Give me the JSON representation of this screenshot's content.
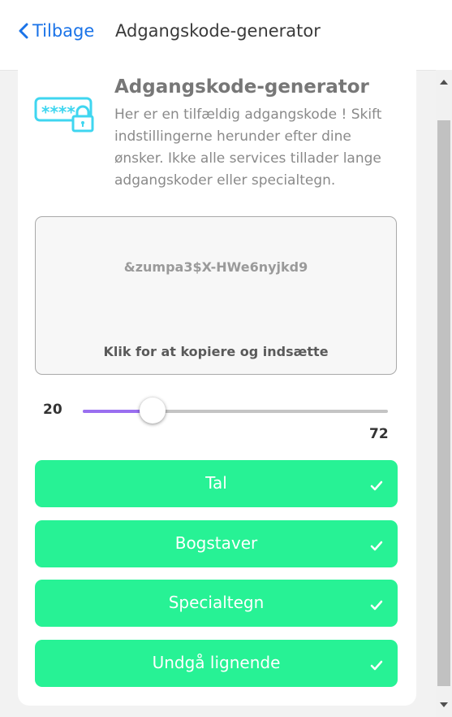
{
  "header": {
    "back_label": "Tilbage",
    "title": "Adgangskode-generator"
  },
  "info": {
    "title": "Adgangskode-generator",
    "description": "Her er en tilfældig adgangskode ! Skift indstillingerne herunder efter dine ønsker. Ikke alle services tillader lange adgangskoder eller specialtegn."
  },
  "password": {
    "value": "&zumpa3$X-HWe6nyjkd9",
    "copy_hint": "Klik for at kopiere og indsætte"
  },
  "slider": {
    "min_label": "20",
    "max_label": "72",
    "fill_fraction": 0.23
  },
  "toggles": [
    {
      "label": "Tal",
      "checked": true
    },
    {
      "label": "Bogstaver",
      "checked": true
    },
    {
      "label": "Specialtegn",
      "checked": true
    },
    {
      "label": "Undgå lignende",
      "checked": true
    }
  ],
  "colors": {
    "accent": "#1a73e8",
    "toggle_green": "#27f295",
    "slider_fill": "#9a6ff0",
    "icon_cyan": "#3fd6f0"
  }
}
